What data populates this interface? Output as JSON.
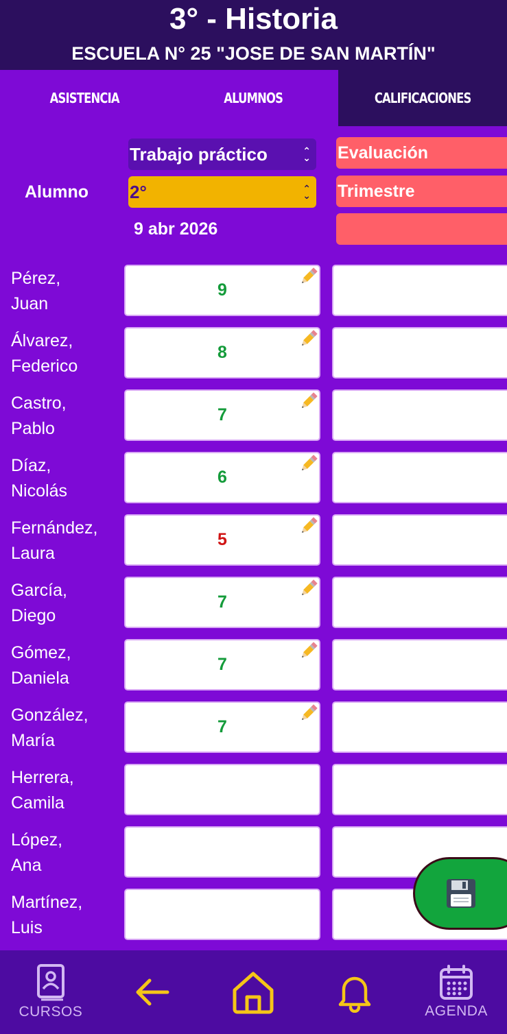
{
  "header": {
    "title": "3° - Historia",
    "subtitle": "ESCUELA N° 25 \"JOSE DE SAN MARTÍN\""
  },
  "tabs": [
    {
      "label": "ASISTENCIA"
    },
    {
      "label": "ALUMNOS"
    },
    {
      "label": "CALIFICACIONES",
      "active": true
    }
  ],
  "controls": {
    "alumno_label": "Alumno",
    "tipo_select": "Trabajo práctico",
    "numero_select": "2°",
    "date": "9 abr 2026",
    "evaluacion_field": "Evaluación",
    "trimestre_field": "Trimestre",
    "extra_field": ""
  },
  "students": [
    {
      "last": "Pérez,",
      "first": "Juan",
      "grade": "9"
    },
    {
      "last": "Álvarez,",
      "first": "Federico",
      "grade": "8"
    },
    {
      "last": "Castro,",
      "first": "Pablo",
      "grade": "7"
    },
    {
      "last": "Díaz,",
      "first": "Nicolás",
      "grade": "6"
    },
    {
      "last": "Fernández,",
      "first": "Laura",
      "grade": "5"
    },
    {
      "last": "García,",
      "first": "Diego",
      "grade": "7"
    },
    {
      "last": "Gómez,",
      "first": "Daniela",
      "grade": "7"
    },
    {
      "last": "González,",
      "first": "María",
      "grade": "7"
    },
    {
      "last": "Herrera,",
      "first": "Camila",
      "grade": ""
    },
    {
      "last": "López,",
      "first": "Ana",
      "grade": ""
    },
    {
      "last": "Martínez,",
      "first": "Luis",
      "grade": ""
    }
  ],
  "colors": {
    "background": "#7e0ad6",
    "header": "#2c0f5e",
    "pass_grade": "#149b3a",
    "fail_grade": "#d01515",
    "accent_yellow": "#f2b300",
    "accent_red": "#ff5f68",
    "save_button": "#12a53d"
  },
  "bottom_nav": {
    "cursos_label": "CURSOS",
    "agenda_label": "AGENDA",
    "icons": [
      "contact-book-icon",
      "arrow-left-icon",
      "home-icon",
      "bell-icon",
      "calendar-icon"
    ]
  },
  "save_button": {
    "icon": "floppy-disk-icon"
  }
}
